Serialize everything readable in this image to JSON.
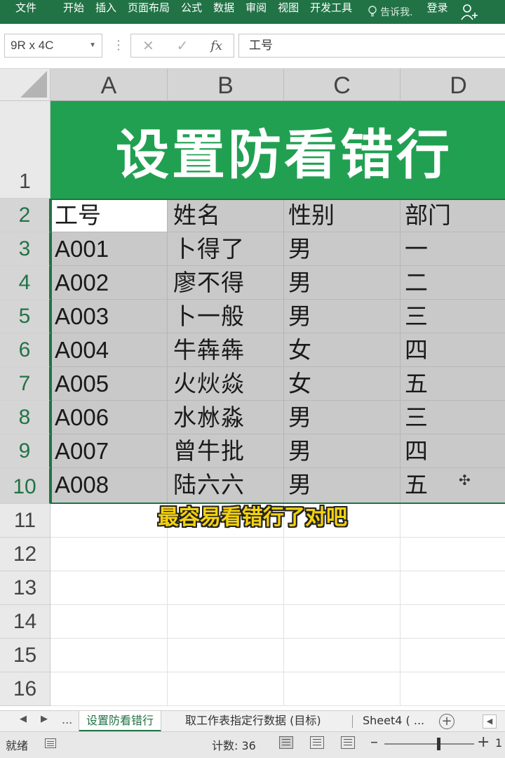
{
  "ribbon": {
    "tabs": [
      "文件",
      "开始",
      "插入",
      "页面布局",
      "公式",
      "数据",
      "审阅",
      "视图",
      "开发工具"
    ],
    "tell_me": "告诉我.",
    "login": "登录",
    "accent": "#217346"
  },
  "formula_bar": {
    "name_box": "9R x 4C",
    "fx_label": "fx",
    "cancel_icon": "close-icon",
    "enter_icon": "check-icon",
    "content": "工号"
  },
  "grid": {
    "columns": [
      "A",
      "B",
      "C",
      "D"
    ],
    "rows": [
      "1",
      "2",
      "3",
      "4",
      "5",
      "6",
      "7",
      "8",
      "9",
      "10",
      "11",
      "12",
      "13",
      "14",
      "15",
      "16"
    ],
    "title": "设置防看错行",
    "title_color": "#21a052",
    "table": [
      [
        "工号",
        "姓名",
        "性别",
        "部门"
      ],
      [
        "A001",
        "卜得了",
        "男",
        "一"
      ],
      [
        "A002",
        "廖不得",
        "男",
        "二"
      ],
      [
        "A003",
        "卜一般",
        "男",
        "三"
      ],
      [
        "A004",
        "牛犇犇",
        "女",
        "四"
      ],
      [
        "A005",
        "火炏焱",
        "女",
        "五"
      ],
      [
        "A006",
        "水沝淼",
        "男",
        "三"
      ],
      [
        "A007",
        "曾牛批",
        "男",
        "四"
      ],
      [
        "A008",
        "陆六六",
        "男",
        "五"
      ]
    ]
  },
  "subtitle": "最容易看错行了对吧",
  "sheets": {
    "more": "...",
    "tabs": [
      "设置防看错行",
      "取工作表指定行数据 (目标)",
      "Sheet4 ( ..."
    ],
    "active": 0
  },
  "status": {
    "ready": "就绪",
    "count": "计数: 36",
    "zoom": "1"
  }
}
